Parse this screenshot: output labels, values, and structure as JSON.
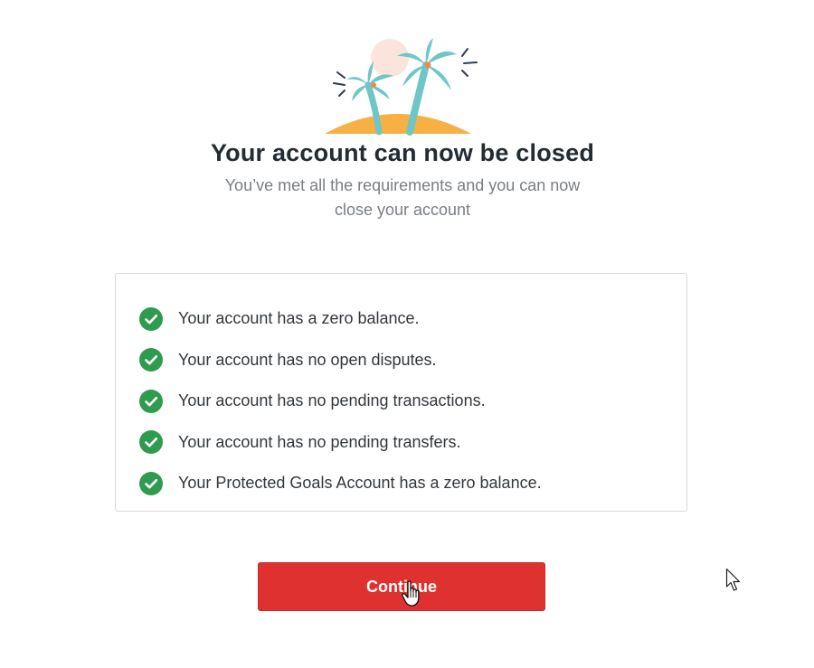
{
  "hero": {
    "icon": "palm-island-icon"
  },
  "header": {
    "title": "Your account can now be closed",
    "subtitle": "You’ve met all the requirements and you can now close your account"
  },
  "requirements": {
    "icon": "check-circle-icon",
    "check_color": "#2e9b4f",
    "items": [
      {
        "label": "Your account has a zero balance."
      },
      {
        "label": "Your account has no open disputes."
      },
      {
        "label": "Your account has no pending transactions."
      },
      {
        "label": "Your account has no pending transfers."
      },
      {
        "label": "Your Protected Goals Account has a zero balance."
      }
    ]
  },
  "actions": {
    "continue_label": "Continue",
    "continue_color": "#e03131"
  }
}
